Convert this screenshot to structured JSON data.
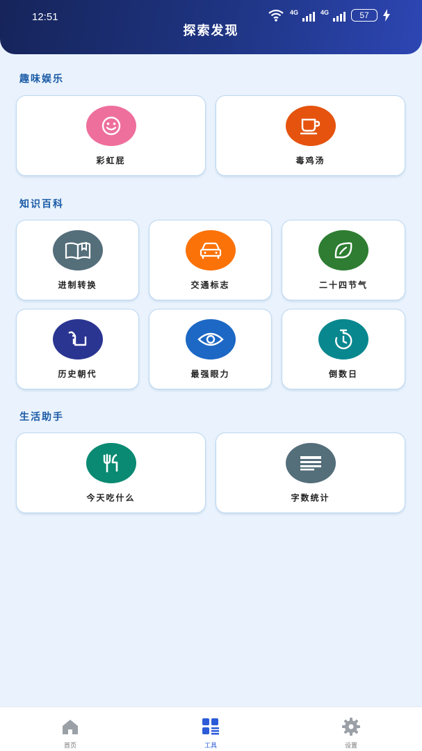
{
  "status_bar": {
    "time": "12:51",
    "network_1": "4G",
    "network_2": "4G",
    "battery": "57"
  },
  "header": {
    "title": "探索发现"
  },
  "sections": [
    {
      "title": "趣味娱乐",
      "items": [
        {
          "label": "彩虹屁",
          "icon": "smiley-icon",
          "color": "#ee6f9c"
        },
        {
          "label": "毒鸡汤",
          "icon": "cup-icon",
          "color": "#e5530f"
        }
      ]
    },
    {
      "title": "知识百科",
      "items": [
        {
          "label": "进制转换",
          "icon": "book-icon",
          "color": "#546e7a"
        },
        {
          "label": "交通标志",
          "icon": "car-icon",
          "color": "#fb7208"
        },
        {
          "label": "二十四节气",
          "icon": "leaf-icon",
          "color": "#2e7d32"
        },
        {
          "label": "历史朝代",
          "icon": "scroll-icon",
          "color": "#2a3592"
        },
        {
          "label": "最强眼力",
          "icon": "eye-icon",
          "color": "#1c68c4"
        },
        {
          "label": "倒数日",
          "icon": "timer-icon",
          "color": "#09878f"
        }
      ]
    },
    {
      "title": "生活助手",
      "items": [
        {
          "label": "今天吃什么",
          "icon": "fork-knife-icon",
          "color": "#0a8a72"
        },
        {
          "label": "字数统计",
          "icon": "text-lines-icon",
          "color": "#546e7a"
        }
      ]
    }
  ],
  "bottom_nav": [
    {
      "label": "首页",
      "icon": "home-icon",
      "active": false
    },
    {
      "label": "工具",
      "icon": "grid-icon",
      "active": true
    },
    {
      "label": "设置",
      "icon": "gear-icon",
      "active": false
    }
  ]
}
